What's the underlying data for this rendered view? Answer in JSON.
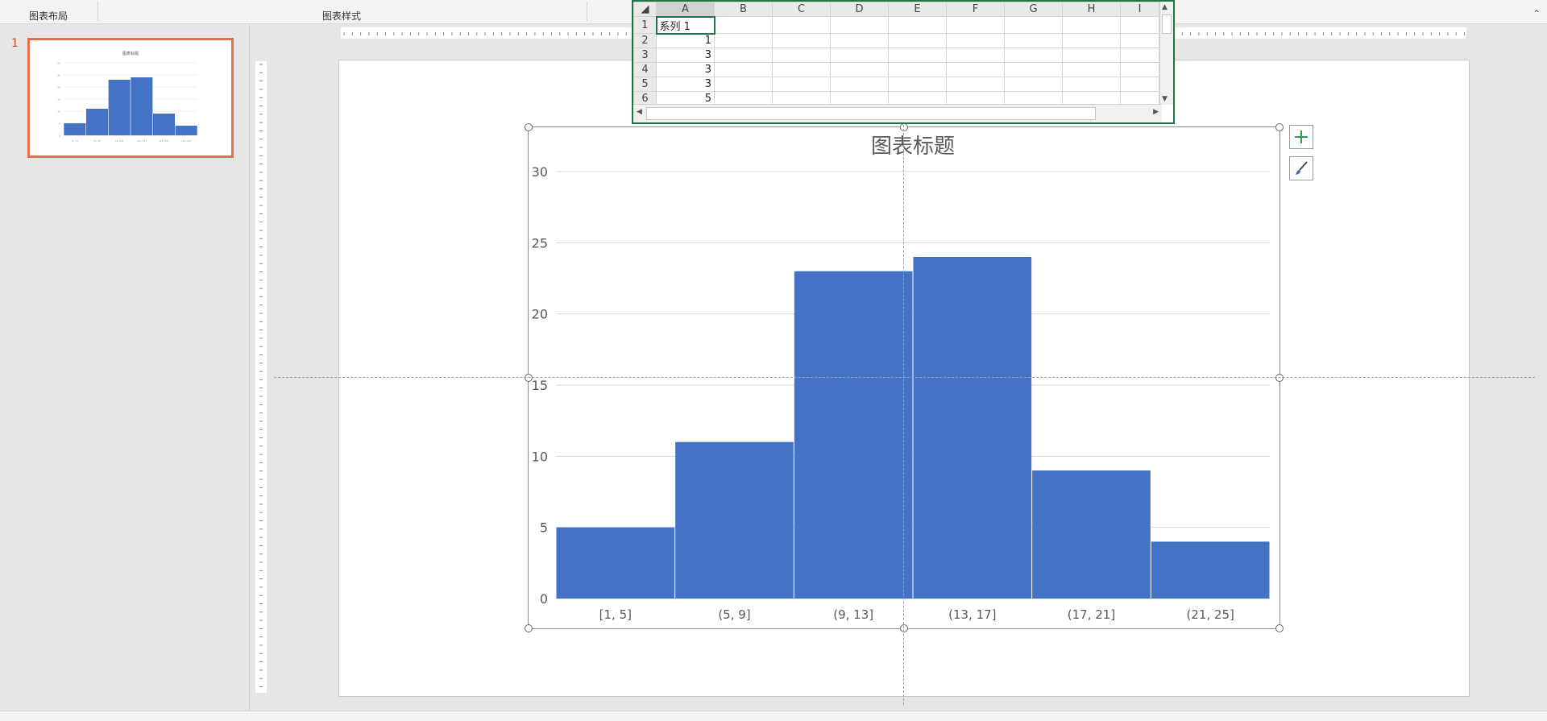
{
  "ribbon": {
    "group_chart_layout": "图表布局",
    "group_chart_styles": "图表样式"
  },
  "slides_pane": {
    "slide_number": "1"
  },
  "spreadsheet": {
    "columns": [
      "A",
      "B",
      "C",
      "D",
      "E",
      "F",
      "G",
      "H",
      "I"
    ],
    "rows": [
      {
        "n": "1",
        "a": "系列 1"
      },
      {
        "n": "2",
        "a": "1"
      },
      {
        "n": "3",
        "a": "3"
      },
      {
        "n": "4",
        "a": "3"
      },
      {
        "n": "5",
        "a": "3"
      },
      {
        "n": "6",
        "a": "5"
      }
    ]
  },
  "colors": {
    "bar": "#4472c4",
    "accent": "#217346",
    "thumb_border": "#e8704e"
  },
  "chart_data": {
    "type": "bar",
    "title": "图表标题",
    "categories": [
      "[1, 5]",
      "(5, 9]",
      "(9, 13]",
      "(13, 17]",
      "(17, 21]",
      "(21, 25]"
    ],
    "values": [
      5,
      11,
      23,
      24,
      9,
      4
    ],
    "ylim": [
      0,
      30
    ],
    "yticks": [
      0,
      5,
      10,
      15,
      20,
      25,
      30
    ],
    "grid": true,
    "gap": "none (histogram)",
    "legend": "none"
  }
}
